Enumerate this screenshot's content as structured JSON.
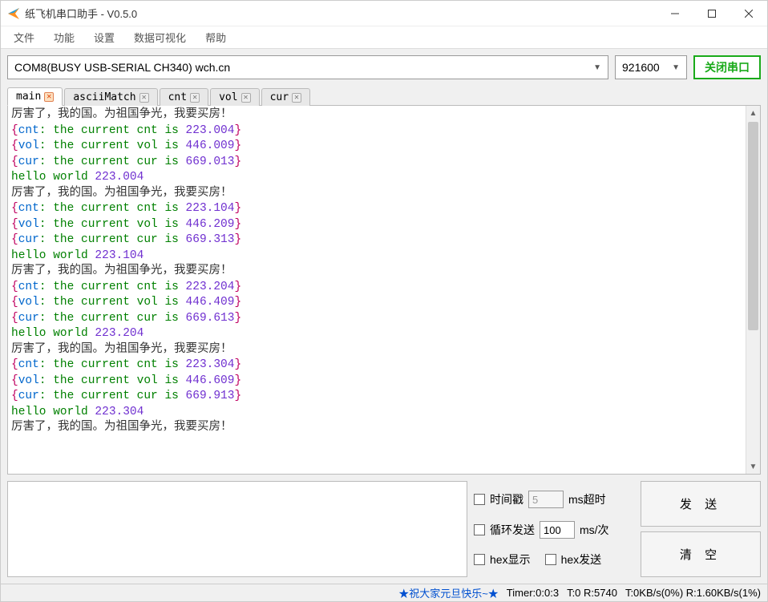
{
  "window": {
    "title": "纸飞机串口助手 - V0.5.0"
  },
  "menu": {
    "file": "文件",
    "function": "功能",
    "settings": "设置",
    "datavis": "数据可视化",
    "help": "帮助"
  },
  "toolbar": {
    "port": "COM8(BUSY  USB-SERIAL CH340) wch.cn",
    "baud": "921600",
    "close_port": "关闭串口"
  },
  "tabs": {
    "main": "main",
    "asciiMatch": "asciiMatch",
    "cnt": "cnt",
    "vol": "vol",
    "cur": "cur"
  },
  "log_blocks": [
    {
      "cn": "厉害了，我的国。为祖国争光，我要买房！",
      "cnt_txt": ": the current cnt is ",
      "cnt_val": "223.004",
      "vol_txt": ": the current vol is ",
      "vol_val": "446.009",
      "cur_txt": ": the current cur is ",
      "cur_val": "669.013",
      "hello": "hello world ",
      "hello_val": "223.004"
    },
    {
      "cn": "厉害了，我的国。为祖国争光，我要买房！",
      "cnt_txt": ": the current cnt is ",
      "cnt_val": "223.104",
      "vol_txt": ": the current vol is ",
      "vol_val": "446.209",
      "cur_txt": ": the current cur is ",
      "cur_val": "669.313",
      "hello": "hello world ",
      "hello_val": "223.104"
    },
    {
      "cn": "厉害了，我的国。为祖国争光，我要买房！",
      "cnt_txt": ": the current cnt is ",
      "cnt_val": "223.204",
      "vol_txt": ": the current vol is ",
      "vol_val": "446.409",
      "cur_txt": ": the current cur is ",
      "cur_val": "669.613",
      "hello": "hello world ",
      "hello_val": "223.204"
    },
    {
      "cn": "厉害了，我的国。为祖国争光，我要买房！",
      "cnt_txt": ": the current cnt is ",
      "cnt_val": "223.304",
      "vol_txt": ": the current vol is ",
      "vol_val": "446.609",
      "cur_txt": ": the current cur is ",
      "cur_val": "669.913",
      "hello": "hello world ",
      "hello_val": "223.304"
    }
  ],
  "trailing_cn": "厉害了，我的国。为祖国争光，我要买房！",
  "options": {
    "timestamp_label": "时间戳",
    "timeout_value": "5",
    "timeout_unit": "ms超时",
    "loop_label": "循环发送",
    "loop_value": "100",
    "loop_unit": "ms/次",
    "hex_display": "hex显示",
    "hex_send": "hex发送"
  },
  "actions": {
    "send": "发 送",
    "clear": "清 空"
  },
  "status": {
    "greeting": "★祝大家元旦快乐~★",
    "timer": "Timer:0:0:3",
    "tr": "T:0 R:5740",
    "rate": "T:0KB/s(0%) R:1.60KB/s(1%)"
  }
}
